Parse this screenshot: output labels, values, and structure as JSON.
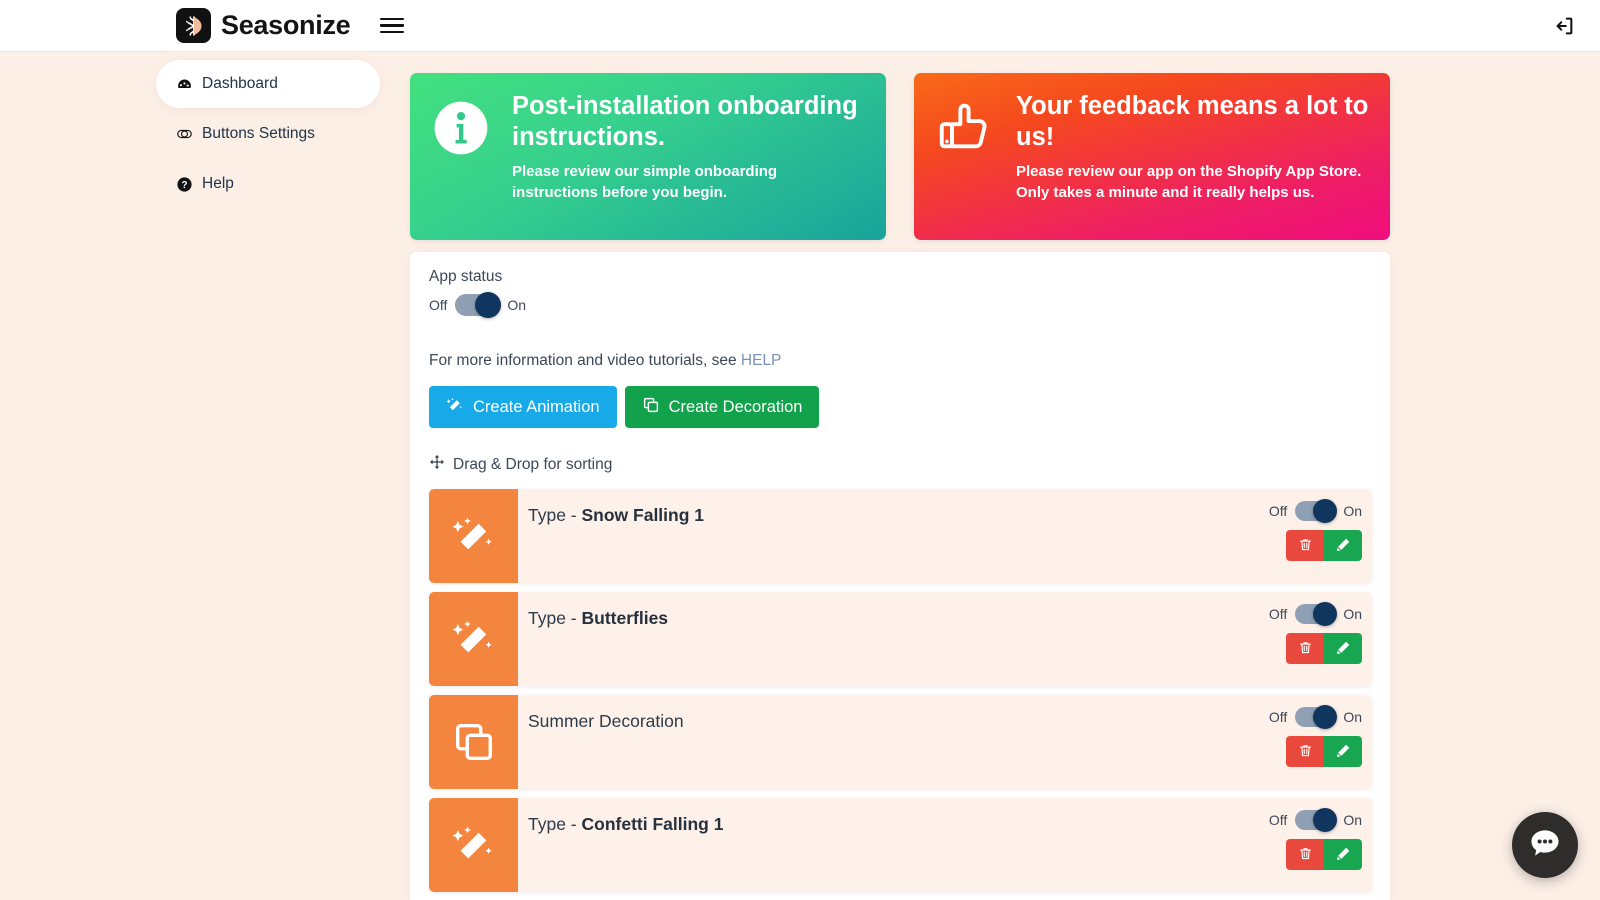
{
  "header": {
    "brand": "Seasonize",
    "logo_icon": "snowflake-sun-logo",
    "menu_icon": "hamburger-menu-icon",
    "logout_icon": "sign-out-icon"
  },
  "sidebar": {
    "items": [
      {
        "label": "Dashboard",
        "icon": "tachometer-icon",
        "active": true
      },
      {
        "label": "Buttons Settings",
        "icon": "toggle-icon",
        "active": false
      },
      {
        "label": "Help",
        "icon": "question-circle-icon",
        "active": false
      }
    ]
  },
  "alerts": [
    {
      "title": "Post-installation onboarding instructions.",
      "subtitle": "Please review our simple onboarding instructions before you begin.",
      "icon": "info-circle-icon",
      "color_from": "#43e07e",
      "color_to": "#19a39c"
    },
    {
      "title": "Your feedback means a lot to us!",
      "subtitle": "Please review our app on the Shopify App Store. Only takes a minute and it really helps us.",
      "icon": "thumbs-up-icon",
      "color_from": "#f96a18",
      "color_to": "#f00d7f"
    }
  ],
  "panel": {
    "app_status_label": "App status",
    "app_status": {
      "off_label": "Off",
      "on_label": "On",
      "value": "On"
    },
    "help_text": "For more information and video tutorials, see",
    "help_link": "HELP",
    "buttons": [
      {
        "label": "Create Animation",
        "icon": "magic-wand-icon",
        "color": "#17a9e8"
      },
      {
        "label": "Create Decoration",
        "icon": "layers-copy-icon",
        "color": "#13a24c"
      }
    ],
    "sort_hint": "Drag & Drop for sorting",
    "sort_icon": "arrows-move-icon"
  },
  "effects": [
    {
      "prefix": "Type - ",
      "name": "Snow Falling 1",
      "icon": "magic-wand-icon",
      "toggle": {
        "off_label": "Off",
        "on_label": "On",
        "value": "On"
      },
      "delete_icon": "trash-icon",
      "edit_icon": "pencil-icon"
    },
    {
      "prefix": "Type - ",
      "name": "Butterflies",
      "icon": "magic-wand-icon",
      "toggle": {
        "off_label": "Off",
        "on_label": "On",
        "value": "On"
      },
      "delete_icon": "trash-icon",
      "edit_icon": "pencil-icon"
    },
    {
      "prefix": "",
      "name": "Summer Decoration",
      "icon": "layers-copy-icon",
      "toggle": {
        "off_label": "Off",
        "on_label": "On",
        "value": "On"
      },
      "delete_icon": "trash-icon",
      "edit_icon": "pencil-icon"
    },
    {
      "prefix": "Type - ",
      "name": "Confetti Falling 1",
      "icon": "magic-wand-icon",
      "toggle": {
        "off_label": "Off",
        "on_label": "On",
        "value": "On"
      },
      "delete_icon": "trash-icon",
      "edit_icon": "pencil-icon"
    }
  ],
  "chat": {
    "icon": "chat-bubble-icon"
  }
}
